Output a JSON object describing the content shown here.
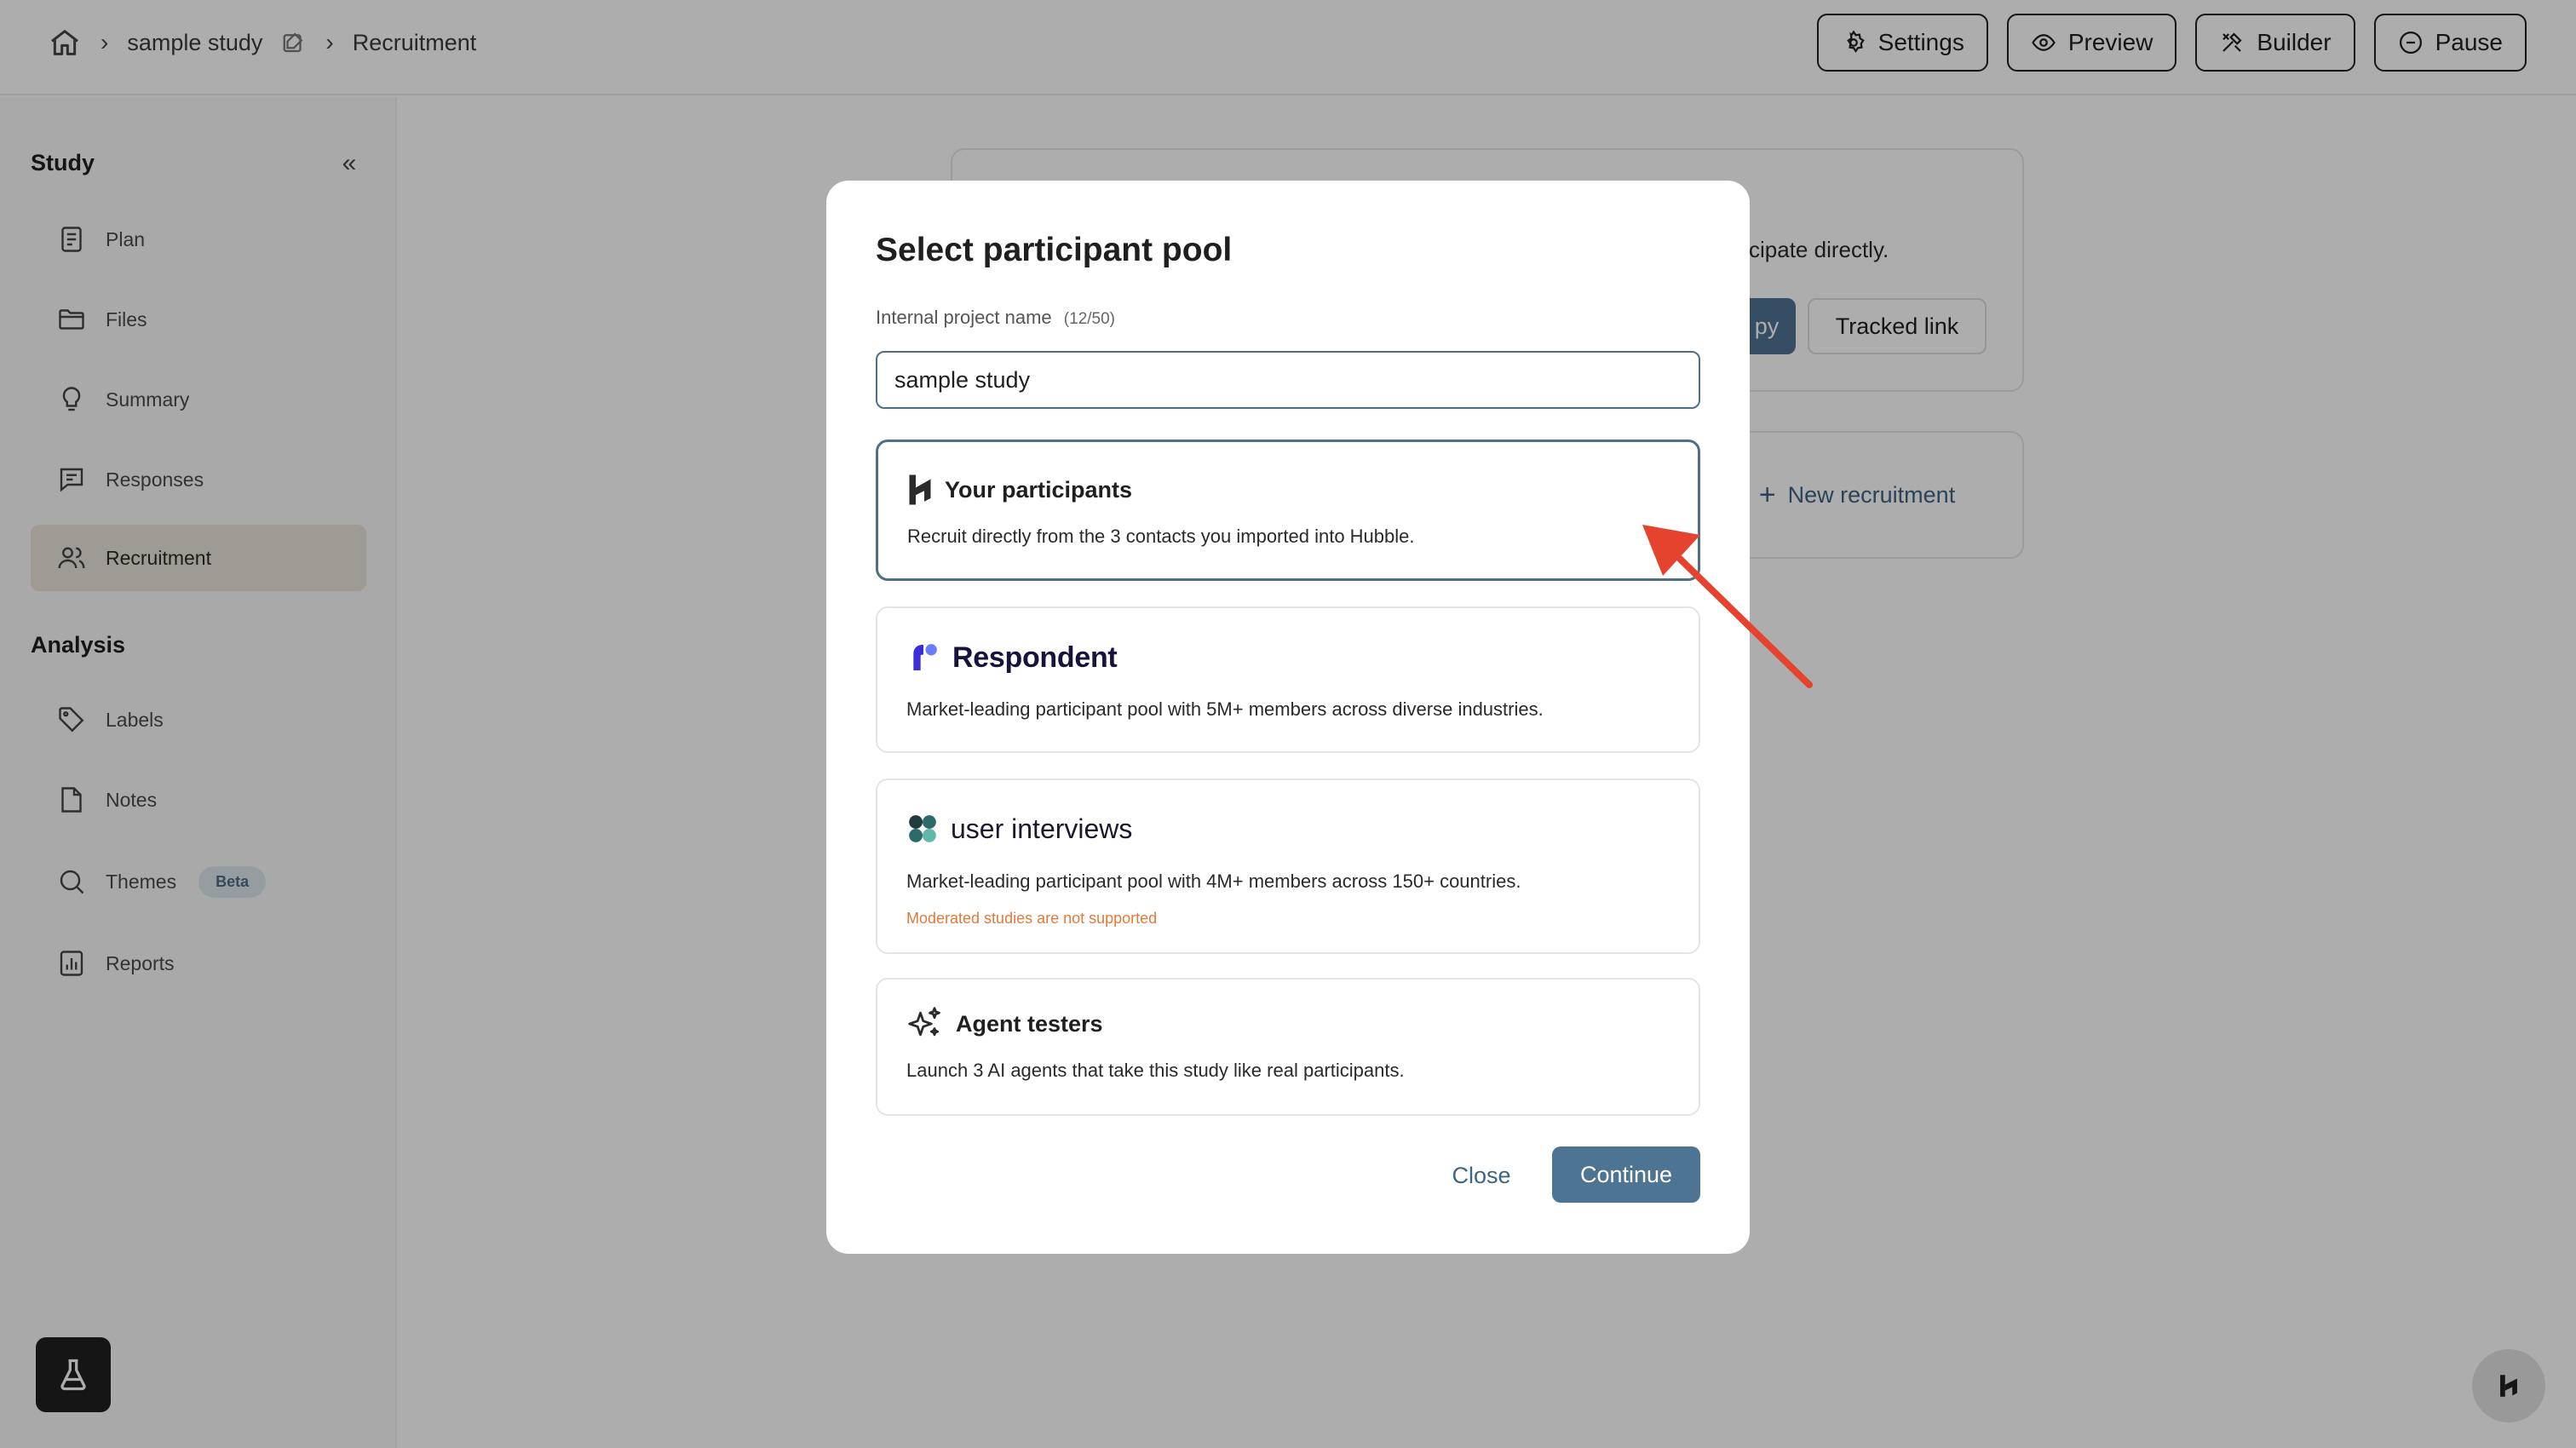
{
  "breadcrumb": {
    "study_name": "sample study",
    "current_page": "Recruitment"
  },
  "top_actions": [
    {
      "label": "Settings",
      "icon": "gear-icon"
    },
    {
      "label": "Preview",
      "icon": "eye-icon"
    },
    {
      "label": "Builder",
      "icon": "tools-icon"
    },
    {
      "label": "Pause",
      "icon": "pause-circle-icon"
    }
  ],
  "sidebar": {
    "study_heading": "Study",
    "study_items": [
      {
        "label": "Plan",
        "icon": "document-icon"
      },
      {
        "label": "Files",
        "icon": "folder-icon"
      },
      {
        "label": "Summary",
        "icon": "lightbulb-icon"
      },
      {
        "label": "Responses",
        "icon": "chat-icon"
      },
      {
        "label": "Recruitment",
        "icon": "users-icon",
        "active": true
      }
    ],
    "analysis_heading": "Analysis",
    "analysis_items": [
      {
        "label": "Labels",
        "icon": "tag-icon"
      },
      {
        "label": "Notes",
        "icon": "note-icon"
      },
      {
        "label": "Themes",
        "icon": "search-icon",
        "badge": "Beta"
      },
      {
        "label": "Reports",
        "icon": "bar-chart-icon"
      }
    ]
  },
  "background": {
    "partial_text": "ticipate directly.",
    "copy_button_partial": "py",
    "tracked_link_label": "Tracked link",
    "new_recruitment_label": "New recruitment"
  },
  "modal": {
    "title": "Select participant pool",
    "field_label": "Internal project name",
    "field_count": "(12/50)",
    "field_value": "sample study",
    "pools": [
      {
        "name": "Your participants",
        "description": "Recruit directly from the 3 contacts you imported into Hubble.",
        "selected": true
      },
      {
        "name": "Respondent",
        "description": "Market-leading participant pool with 5M+ members across diverse industries."
      },
      {
        "name": "user interviews",
        "description": "Market-leading participant pool with 4M+ members across 150+ countries.",
        "warning": "Moderated studies are not supported"
      },
      {
        "name": "Agent testers",
        "description": "Launch 3 AI agents that take this study like real participants."
      }
    ],
    "close_label": "Close",
    "continue_label": "Continue"
  },
  "colors": {
    "accent": "#4e7493",
    "selected_border": "#4e6f86",
    "warning": "#e07a3c",
    "annotation_arrow": "#e5432e",
    "active_sidebar_bg": "#ece4dc",
    "respondent_brand": "#3b2bd9"
  }
}
